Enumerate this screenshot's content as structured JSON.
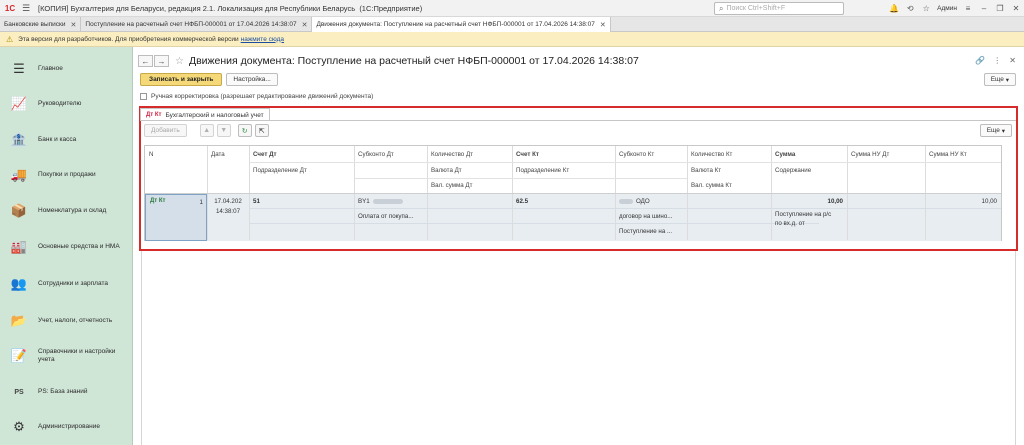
{
  "titlebar": {
    "logo_text": "1С",
    "title": "[КОПИЯ] Бухгалтерия для Беларуси, редакция 2.1. Локализация для Республики Беларусь",
    "mode": "(1С:Предприятие)",
    "search_placeholder": "Поиск Ctrl+Shift+F",
    "user": "Админ"
  },
  "tabs": [
    {
      "label": "Банковские выписки"
    },
    {
      "label": "Поступление на расчетный счет НФБП-000001 от 17.04.2026 14:38:07"
    },
    {
      "label": "Движения документа: Поступление на расчетный счет НФБП-000001 от 17.04.2026 14:38:07"
    }
  ],
  "notice": {
    "text": "Эта версия для разработчиков. Для приобретения коммерческой версии",
    "link": "нажмите сюда"
  },
  "sidebar": {
    "items": [
      {
        "label": "Главное",
        "icon": "☰"
      },
      {
        "label": "Руководителю",
        "icon": "📈"
      },
      {
        "label": "Банк и касса",
        "icon": "🏦"
      },
      {
        "label": "Покупки и продажи",
        "icon": "🚚"
      },
      {
        "label": "Номенклатура и склад",
        "icon": "📦"
      },
      {
        "label": "Основные средства и НМА",
        "icon": "🏭"
      },
      {
        "label": "Сотрудники и зарплата",
        "icon": "👥"
      },
      {
        "label": "Учет, налоги, отчетность",
        "icon": "📂"
      },
      {
        "label": "Справочники и настройки учета",
        "icon": "📝"
      },
      {
        "label": "PS: База знаний",
        "icon": "PS"
      },
      {
        "label": "Администрирование",
        "icon": "⚙"
      }
    ]
  },
  "header": {
    "title": "Движения документа: Поступление на расчетный счет НФБП-000001 от 17.04.2026 14:38:07"
  },
  "toolbar": {
    "save_close": "Записать и закрыть",
    "settings": "Настройка...",
    "more": "Еще"
  },
  "manual": {
    "label": "Ручная корректировка (разрешает редактирование движений документа)"
  },
  "register_tab": {
    "label": "Бухгалтерский и налоговый учет",
    "icon_text": "Дт Кт"
  },
  "grid_toolbar": {
    "add": "Добавить",
    "more": "Еще"
  },
  "grid": {
    "headers": {
      "n": "N",
      "date": "Дата",
      "acc_dt": "Счет Дт",
      "dept_dt": "Подразделение Дт",
      "sub_dt": "Субконто Дт",
      "qty_dt": "Количество Дт",
      "cur_dt": "Валюта Дт",
      "cur_sum_dt": "Вал. сумма Дт",
      "acc_kt": "Счет Кт",
      "dept_kt": "Подразделение Кт",
      "sub_kt": "Субконто Кт",
      "qty_kt": "Количество Кт",
      "cur_kt": "Валюта Кт",
      "cur_sum_kt": "Вал. сумма Кт",
      "sum": "Сумма",
      "content": "Содержание",
      "sum_nu_dt": "Сумма НУ Дт",
      "sum_nu_kt": "Сумма НУ Кт"
    },
    "row": {
      "n": "1",
      "date_line1": "17.04.202",
      "date_line2": "14:38:07",
      "acc_dt": "51",
      "sub_dt_1": "BY1",
      "sub_dt_2": "Оплата от покупа...",
      "acc_kt": "62.5",
      "sub_kt_1": "ОДО",
      "sub_kt_2": "договор на шино...",
      "sub_kt_3": "Поступление на ...",
      "sum": "10,00",
      "content_line1": "Поступление на р/с",
      "content_line2": "по вх.д. от",
      "sum_nu_kt": "10,00"
    }
  }
}
